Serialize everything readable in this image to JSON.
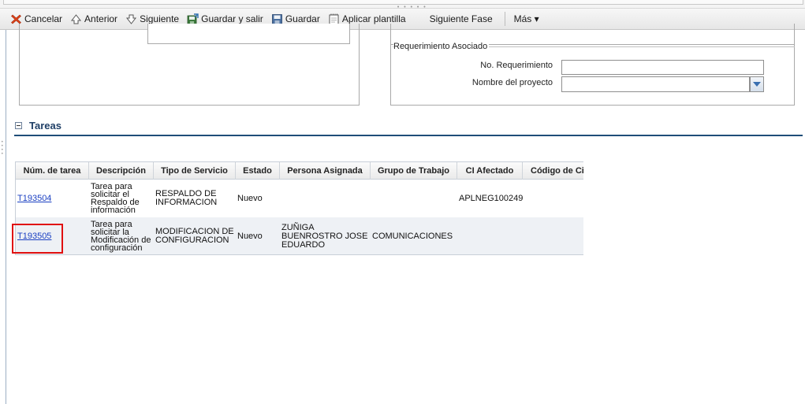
{
  "toolbar": {
    "cancel": "Cancelar",
    "previous": "Anterior",
    "next": "Siguiente",
    "save_exit": "Guardar y salir",
    "save": "Guardar",
    "apply_template": "Aplicar plantilla",
    "next_phase": "Siguiente Fase",
    "more": "Más ▾"
  },
  "requirement": {
    "legend": "Requerimiento Asociado",
    "number_label": "No. Requerimiento",
    "number_value": "",
    "project_label": "Nombre del proyecto",
    "project_value": ""
  },
  "tasks": {
    "title": "Tareas",
    "columns": [
      "Núm. de tarea",
      "Descripción",
      "Tipo de Servicio",
      "Estado",
      "Persona Asignada",
      "Grupo de Trabajo",
      "CI Afectado",
      "Código de Ci"
    ],
    "rows": [
      {
        "id": "T193504",
        "description": [
          "Tarea para",
          "solicitar el",
          "Respaldo de",
          "información"
        ],
        "service_type": [
          "RESPALDO DE",
          "INFORMACION"
        ],
        "status": "Nuevo",
        "assignee": [],
        "group": "",
        "ci": "APLNEG100249",
        "ci_code": ""
      },
      {
        "id": "T193505",
        "description": [
          "Tarea para",
          "solicitar la",
          "Modificación de",
          "configuración"
        ],
        "service_type": [
          "MODIFICACION DE",
          "CONFIGURACION"
        ],
        "status": "Nuevo",
        "assignee": [
          "ZUÑIGA",
          "BUENROSTRO JOSE",
          "EDUARDO"
        ],
        "group": "COMUNICACIONES",
        "ci": "",
        "ci_code": ""
      }
    ]
  },
  "colors": {
    "accent": "#1f4e79",
    "link": "#1a3fc2",
    "highlight": "#e01010"
  },
  "icons": [
    "cancel-icon",
    "previous-icon",
    "next-icon",
    "save-exit-icon",
    "save-icon",
    "template-icon",
    "dropdown-arrow-icon",
    "collapse-icon"
  ]
}
